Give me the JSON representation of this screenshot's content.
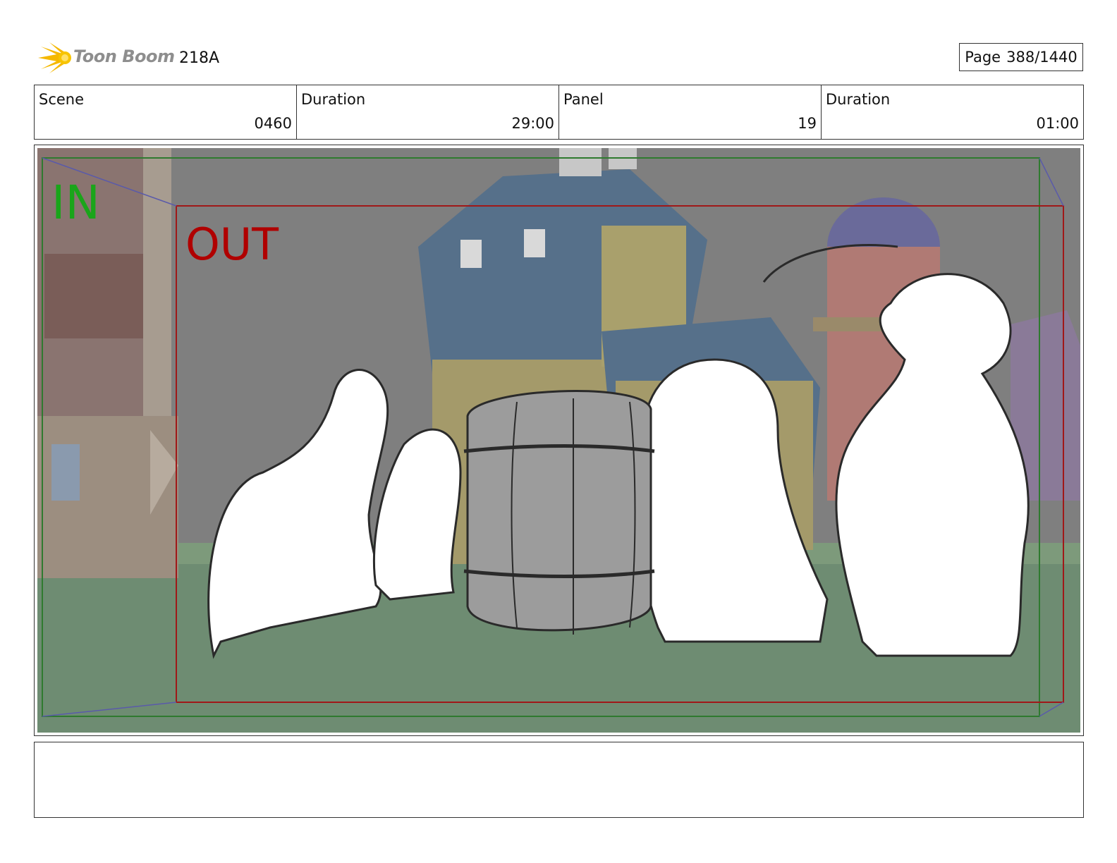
{
  "header": {
    "logo_text": "Toon Boom",
    "project": "218A",
    "page_label": "Page",
    "page_value": "388/1440"
  },
  "info": {
    "scene_label": "Scene",
    "scene_value": "0460",
    "duration_label": "Duration",
    "duration_value": "29:00",
    "panel_label": "Panel",
    "panel_value": "19",
    "panel_duration_label": "Duration",
    "panel_duration_value": "01:00"
  },
  "frame": {
    "in_label": "IN",
    "out_label": "OUT",
    "in_color": "#1aa51a",
    "out_color": "#b00000"
  },
  "notes": {
    "text": ""
  }
}
